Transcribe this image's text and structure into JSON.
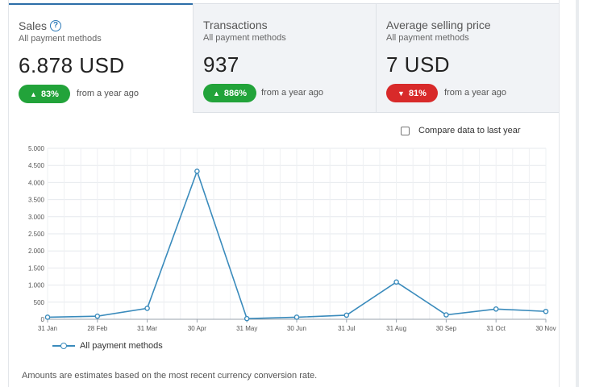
{
  "kpis": [
    {
      "title": "Sales",
      "subtitle": "All payment methods",
      "value": "6.878 USD",
      "change": "83%",
      "direction": "up",
      "note": "from a year ago",
      "help_icon": "question-circle-icon"
    },
    {
      "title": "Transactions",
      "subtitle": "All payment methods",
      "value": "937",
      "change": "886%",
      "direction": "up",
      "note": "from a year ago"
    },
    {
      "title": "Average selling price",
      "subtitle": "All payment methods",
      "value": "7 USD",
      "change": "81%",
      "direction": "down",
      "note": "from a year ago"
    }
  ],
  "compare": {
    "label": "Compare data to last year",
    "checked": false
  },
  "chart_data": {
    "type": "line",
    "categories": [
      "31 Jan",
      "28 Feb",
      "31 Mar",
      "30 Apr",
      "31 May",
      "30 Jun",
      "31 Jul",
      "31 Aug",
      "30 Sep",
      "31 Oct",
      "30 Nov"
    ],
    "series": [
      {
        "name": "All payment methods",
        "values": [
          60,
          90,
          320,
          4330,
          20,
          60,
          120,
          1090,
          130,
          300,
          230
        ]
      }
    ],
    "yticks": [
      "0",
      "500",
      "1.000",
      "1.500",
      "2.000",
      "2.500",
      "3.000",
      "3.500",
      "4.000",
      "4.500",
      "5.000"
    ],
    "ylim": [
      0,
      5000
    ],
    "grid": true,
    "legend": "bottom-left",
    "color": "#3a8bbc"
  },
  "footnote": "Amounts are estimates based on the most recent currency conversion rate.",
  "colors": {
    "up": "#22a33a",
    "down": "#d82a2a",
    "accent": "#2c6ea8"
  }
}
